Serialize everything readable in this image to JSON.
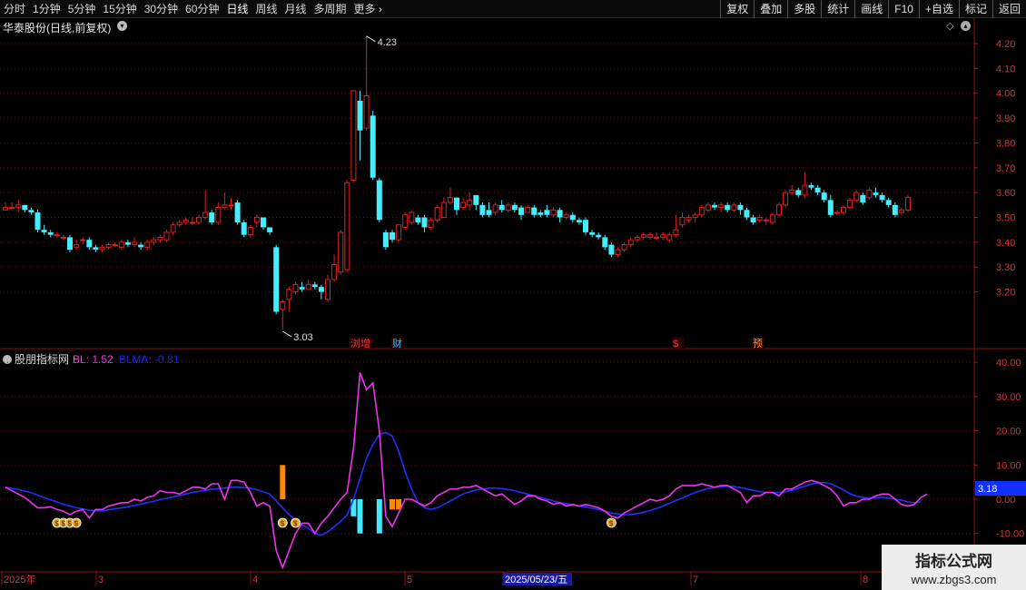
{
  "toolbar": {
    "periods": [
      "分时",
      "1分钟",
      "5分钟",
      "15分钟",
      "30分钟",
      "60分钟",
      "日线",
      "周线",
      "月线",
      "多周期",
      "更多"
    ],
    "active": "日线",
    "right_buttons": [
      "复权",
      "叠加",
      "多股",
      "统计",
      "画线",
      "F10",
      "+自选",
      "标记",
      "返回"
    ]
  },
  "main_chart": {
    "title": "华泰股份(日线,前复权)",
    "y_ticks": [
      "4.20",
      "4.10",
      "4.00",
      "3.90",
      "3.80",
      "3.70",
      "3.60",
      "3.50",
      "3.40",
      "3.30",
      "3.20"
    ],
    "high_label": "4.23",
    "low_label": "3.03",
    "event_markers": [
      {
        "text": "浏增",
        "color": "#ff3333"
      },
      {
        "text": "财",
        "color": "#33bbff"
      },
      {
        "text": "$",
        "color": "#ff3333"
      },
      {
        "text": "预",
        "color": "#ff9922"
      }
    ],
    "candles": [
      [
        3.53,
        3.54,
        3.56,
        3.53
      ],
      [
        3.54,
        3.54,
        3.56,
        3.53
      ],
      [
        3.54,
        3.55,
        3.57,
        3.52
      ],
      [
        3.55,
        3.53,
        3.55,
        3.52
      ],
      [
        3.53,
        3.52,
        3.54,
        3.51
      ],
      [
        3.52,
        3.45,
        3.53,
        3.44
      ],
      [
        3.45,
        3.44,
        3.47,
        3.43
      ],
      [
        3.44,
        3.43,
        3.45,
        3.42
      ],
      [
        3.43,
        3.43,
        3.44,
        3.42
      ],
      [
        3.42,
        3.42,
        3.43,
        3.41
      ],
      [
        3.42,
        3.37,
        3.43,
        3.36
      ],
      [
        3.38,
        3.39,
        3.41,
        3.37
      ],
      [
        3.41,
        3.41,
        3.42,
        3.39
      ],
      [
        3.41,
        3.38,
        3.42,
        3.37
      ],
      [
        3.38,
        3.37,
        3.39,
        3.36
      ],
      [
        3.37,
        3.38,
        3.39,
        3.36
      ],
      [
        3.38,
        3.39,
        3.4,
        3.37
      ],
      [
        3.39,
        3.39,
        3.4,
        3.38
      ],
      [
        3.38,
        3.4,
        3.41,
        3.37
      ],
      [
        3.4,
        3.39,
        3.41,
        3.38
      ],
      [
        3.39,
        3.4,
        3.42,
        3.38
      ],
      [
        3.39,
        3.38,
        3.4,
        3.37
      ],
      [
        3.38,
        3.4,
        3.41,
        3.37
      ],
      [
        3.4,
        3.41,
        3.42,
        3.39
      ],
      [
        3.41,
        3.42,
        3.43,
        3.4
      ],
      [
        3.41,
        3.44,
        3.45,
        3.4
      ],
      [
        3.44,
        3.47,
        3.48,
        3.43
      ],
      [
        3.47,
        3.48,
        3.49,
        3.46
      ],
      [
        3.48,
        3.49,
        3.5,
        3.47
      ],
      [
        3.48,
        3.48,
        3.5,
        3.47
      ],
      [
        3.48,
        3.5,
        3.51,
        3.47
      ],
      [
        3.5,
        3.52,
        3.61,
        3.49
      ],
      [
        3.52,
        3.48,
        3.53,
        3.47
      ],
      [
        3.48,
        3.54,
        3.56,
        3.47
      ],
      [
        3.54,
        3.55,
        3.6,
        3.53
      ],
      [
        3.55,
        3.55,
        3.58,
        3.53
      ],
      [
        3.56,
        3.48,
        3.57,
        3.47
      ],
      [
        3.48,
        3.43,
        3.49,
        3.42
      ],
      [
        3.43,
        3.46,
        3.47,
        3.42
      ],
      [
        3.48,
        3.5,
        3.51,
        3.46
      ],
      [
        3.5,
        3.46,
        3.5,
        3.45
      ],
      [
        3.46,
        3.44,
        3.46,
        3.43
      ],
      [
        3.38,
        3.12,
        3.39,
        3.11
      ],
      [
        3.13,
        3.16,
        3.17,
        3.05
      ],
      [
        3.17,
        3.21,
        3.22,
        3.12
      ],
      [
        3.2,
        3.23,
        3.24,
        3.19
      ],
      [
        3.22,
        3.21,
        3.24,
        3.2
      ],
      [
        3.21,
        3.23,
        3.25,
        3.21
      ],
      [
        3.23,
        3.22,
        3.24,
        3.21
      ],
      [
        3.22,
        3.2,
        3.23,
        3.17
      ],
      [
        3.17,
        3.25,
        3.27,
        3.16
      ],
      [
        3.25,
        3.31,
        3.35,
        3.24
      ],
      [
        3.28,
        3.44,
        3.45,
        3.27
      ],
      [
        3.29,
        3.64,
        3.65,
        3.28
      ],
      [
        3.65,
        4.01,
        4.01,
        3.64
      ],
      [
        3.97,
        3.85,
        4.01,
        3.73
      ],
      [
        3.86,
        3.99,
        4.23,
        3.85
      ],
      [
        3.91,
        3.66,
        3.93,
        3.65
      ],
      [
        3.65,
        3.49,
        3.66,
        3.48
      ],
      [
        3.44,
        3.38,
        3.45,
        3.37
      ],
      [
        3.44,
        3.41,
        3.45,
        3.4
      ],
      [
        3.41,
        3.47,
        3.47,
        3.4
      ],
      [
        3.46,
        3.51,
        3.52,
        3.45
      ],
      [
        3.48,
        3.52,
        3.53,
        3.47
      ],
      [
        3.5,
        3.48,
        3.51,
        3.47
      ],
      [
        3.5,
        3.46,
        3.51,
        3.44
      ],
      [
        3.46,
        3.49,
        3.5,
        3.45
      ],
      [
        3.49,
        3.54,
        3.55,
        3.48
      ],
      [
        3.5,
        3.56,
        3.58,
        3.5
      ],
      [
        3.56,
        3.58,
        3.62,
        3.55
      ],
      [
        3.58,
        3.53,
        3.58,
        3.51
      ],
      [
        3.54,
        3.56,
        3.58,
        3.53
      ],
      [
        3.55,
        3.57,
        3.6,
        3.53
      ],
      [
        3.59,
        3.55,
        3.59,
        3.53
      ],
      [
        3.55,
        3.51,
        3.56,
        3.5
      ],
      [
        3.53,
        3.51,
        3.56,
        3.5
      ],
      [
        3.52,
        3.55,
        3.56,
        3.51
      ],
      [
        3.55,
        3.53,
        3.57,
        3.52
      ],
      [
        3.53,
        3.55,
        3.56,
        3.52
      ],
      [
        3.55,
        3.53,
        3.56,
        3.52
      ],
      [
        3.54,
        3.51,
        3.55,
        3.49
      ],
      [
        3.52,
        3.54,
        3.55,
        3.52
      ],
      [
        3.54,
        3.51,
        3.55,
        3.5
      ],
      [
        3.52,
        3.51,
        3.53,
        3.5
      ],
      [
        3.53,
        3.51,
        3.55,
        3.5
      ],
      [
        3.51,
        3.53,
        3.54,
        3.5
      ],
      [
        3.53,
        3.5,
        3.54,
        3.48
      ],
      [
        3.5,
        3.51,
        3.52,
        3.49
      ],
      [
        3.51,
        3.49,
        3.52,
        3.48
      ],
      [
        3.49,
        3.48,
        3.5,
        3.47
      ],
      [
        3.49,
        3.44,
        3.5,
        3.43
      ],
      [
        3.44,
        3.43,
        3.45,
        3.42
      ],
      [
        3.43,
        3.42,
        3.44,
        3.41
      ],
      [
        3.42,
        3.38,
        3.43,
        3.37
      ],
      [
        3.39,
        3.35,
        3.4,
        3.34
      ],
      [
        3.35,
        3.37,
        3.38,
        3.34
      ],
      [
        3.37,
        3.39,
        3.4,
        3.36
      ],
      [
        3.39,
        3.41,
        3.42,
        3.38
      ],
      [
        3.41,
        3.42,
        3.43,
        3.4
      ],
      [
        3.42,
        3.43,
        3.44,
        3.41
      ],
      [
        3.42,
        3.43,
        3.44,
        3.41
      ],
      [
        3.42,
        3.42,
        3.44,
        3.41
      ],
      [
        3.42,
        3.43,
        3.44,
        3.41
      ],
      [
        3.41,
        3.43,
        3.44,
        3.4
      ],
      [
        3.43,
        3.45,
        3.51,
        3.42
      ],
      [
        3.47,
        3.5,
        3.52,
        3.46
      ],
      [
        3.49,
        3.5,
        3.51,
        3.48
      ],
      [
        3.5,
        3.51,
        3.52,
        3.48
      ],
      [
        3.51,
        3.54,
        3.55,
        3.5
      ],
      [
        3.53,
        3.55,
        3.56,
        3.52
      ],
      [
        3.55,
        3.54,
        3.56,
        3.53
      ],
      [
        3.54,
        3.55,
        3.56,
        3.52
      ],
      [
        3.55,
        3.53,
        3.56,
        3.52
      ],
      [
        3.53,
        3.55,
        3.56,
        3.52
      ],
      [
        3.55,
        3.53,
        3.56,
        3.51
      ],
      [
        3.53,
        3.5,
        3.54,
        3.49
      ],
      [
        3.5,
        3.48,
        3.51,
        3.47
      ],
      [
        3.49,
        3.5,
        3.51,
        3.48
      ],
      [
        3.49,
        3.49,
        3.5,
        3.47
      ],
      [
        3.48,
        3.51,
        3.52,
        3.47
      ],
      [
        3.51,
        3.55,
        3.56,
        3.5
      ],
      [
        3.55,
        3.6,
        3.61,
        3.54
      ],
      [
        3.6,
        3.61,
        3.63,
        3.59
      ],
      [
        3.61,
        3.59,
        3.62,
        3.58
      ],
      [
        3.59,
        3.63,
        3.68,
        3.58
      ],
      [
        3.63,
        3.62,
        3.64,
        3.61
      ],
      [
        3.62,
        3.6,
        3.63,
        3.59
      ],
      [
        3.6,
        3.57,
        3.61,
        3.56
      ],
      [
        3.57,
        3.51,
        3.59,
        3.5
      ],
      [
        3.52,
        3.52,
        3.53,
        3.51
      ],
      [
        3.52,
        3.54,
        3.55,
        3.51
      ],
      [
        3.54,
        3.57,
        3.58,
        3.53
      ],
      [
        3.57,
        3.6,
        3.61,
        3.56
      ],
      [
        3.59,
        3.56,
        3.6,
        3.55
      ],
      [
        3.58,
        3.61,
        3.62,
        3.57
      ],
      [
        3.6,
        3.59,
        3.62,
        3.58
      ],
      [
        3.59,
        3.57,
        3.6,
        3.56
      ],
      [
        3.57,
        3.55,
        3.58,
        3.54
      ],
      [
        3.55,
        3.51,
        3.56,
        3.5
      ],
      [
        3.52,
        3.53,
        3.54,
        3.51
      ],
      [
        3.53,
        3.58,
        3.59,
        3.52
      ]
    ]
  },
  "indicator": {
    "name": "股朋指标网",
    "bl_label": "BL: 1.52",
    "blma_label": "BLMA: -0.81",
    "y_ticks": [
      "40.00",
      "30.00",
      "20.00",
      "10.00",
      "0.00",
      "-10.00"
    ],
    "current_value": "3.18"
  },
  "x_axis": {
    "labels": [
      "2025年",
      "3",
      "4",
      "5",
      "2025/05/23/五",
      "7",
      "8"
    ]
  },
  "chart_data": [
    {
      "type": "candlestick",
      "title": "华泰股份(日线,前复权)",
      "ylim": [
        3.03,
        4.23
      ],
      "annotations": [
        "4.23",
        "3.03"
      ],
      "note": "OHLC series in main_chart.candles"
    },
    {
      "type": "line",
      "series_labels": [
        "BL: 1.52",
        "BLMA: -0.81"
      ],
      "ylim": [
        -10,
        40
      ],
      "bl": [
        3.5,
        2.5,
        1.5,
        0.5,
        -1,
        -2.5,
        -2.5,
        -2.2,
        -3,
        -3.5,
        -4.5,
        -3.5,
        -3,
        -5.5,
        -3,
        -3,
        -2,
        -1.5,
        -1,
        -1,
        0,
        -0.5,
        0.5,
        1,
        2.5,
        2,
        2,
        1.5,
        2.5,
        3.5,
        3.5,
        3,
        4.5,
        4.5,
        0,
        5.5,
        5.5,
        5,
        2,
        -2,
        -1,
        -2,
        -15,
        -20,
        -15,
        -10,
        -7,
        -7,
        -10,
        -7,
        -5,
        -2.5,
        0,
        2,
        15,
        37,
        32,
        34,
        20,
        -5,
        -8,
        -4,
        0,
        0,
        -1,
        -2,
        -1,
        1,
        2,
        3,
        3,
        3.5,
        3.5,
        4,
        3,
        2,
        1,
        1.5,
        0,
        -1.5,
        -0.5,
        1,
        1,
        0,
        -0.5,
        -1.5,
        -1,
        -2,
        -1.5,
        -2,
        -1.5,
        -2,
        -2.5,
        -3.5,
        -5,
        -5.5,
        -4,
        -3,
        -2,
        -1,
        0,
        -0.5,
        0,
        1,
        3,
        4,
        4,
        4,
        4.5,
        4,
        3.5,
        4,
        4,
        3,
        2,
        -1,
        1,
        1,
        2,
        2,
        1,
        3,
        3,
        4,
        5,
        5.5,
        5,
        4,
        3,
        1,
        -2,
        -1,
        -1,
        0,
        0,
        1,
        1.5,
        1.5,
        0,
        -1.5,
        -2,
        -1.5,
        0.5,
        1.52
      ],
      "blma": [
        3.5,
        3.2,
        2.8,
        2.4,
        1.9,
        1.2,
        0.5,
        -0.2,
        -0.8,
        -1.5,
        -2,
        -2.5,
        -2.8,
        -3.2,
        -3.3,
        -3.4,
        -3.1,
        -2.8,
        -2.5,
        -2.2,
        -1.8,
        -1.4,
        -1,
        -0.6,
        -0.1,
        0.3,
        0.7,
        1.1,
        1.5,
        2,
        2.3,
        2.6,
        2.9,
        3.1,
        3.3,
        3.5,
        3.5,
        3.4,
        3.2,
        2.8,
        2.2,
        1.5,
        -0.5,
        -2.5,
        -4.5,
        -6,
        -7.5,
        -8.5,
        -10,
        -10.5,
        -9.5,
        -8,
        -6.5,
        -4.5,
        0,
        6,
        12,
        16,
        19,
        19.5,
        18.5,
        14,
        8,
        3,
        -1,
        -2.5,
        -3,
        -2.5,
        -1.5,
        -0.5,
        0.5,
        1.5,
        2.2,
        2.7,
        3,
        3.2,
        3.3,
        3.1,
        2.8,
        2.5,
        2,
        1.5,
        1,
        0.5,
        0,
        -0.5,
        -1,
        -1.3,
        -1.6,
        -2,
        -2.3,
        -2.6,
        -3,
        -3.5,
        -4,
        -4.3,
        -4.5,
        -4.5,
        -4.2,
        -3.8,
        -3.3,
        -2.7,
        -2,
        -1.2,
        -0.4,
        0.4,
        1.2,
        2,
        2.6,
        3.1,
        3.5,
        3.7,
        3.8,
        3.7,
        3.4,
        3,
        2.6,
        2.2,
        2,
        1.9,
        2,
        2.2,
        2.6,
        3.2,
        3.8,
        4.4,
        4.8,
        4.9,
        4.5,
        3.7,
        2.7,
        1.6,
        0.9,
        0.5,
        0.4,
        0.5,
        0.5,
        0.3,
        0,
        -0.3,
        -0.8,
        -1,
        -0.81
      ],
      "orange_bars": [
        [
          43,
          0,
          10
        ],
        [
          60,
          0,
          -3
        ],
        [
          61,
          0,
          -3
        ]
      ],
      "cyan_bars": [
        [
          54,
          -5
        ],
        [
          55,
          -10
        ],
        [
          58,
          -10
        ]
      ],
      "money_bag_indices": [
        8,
        9,
        10,
        11,
        43,
        45,
        94
      ]
    }
  ]
}
